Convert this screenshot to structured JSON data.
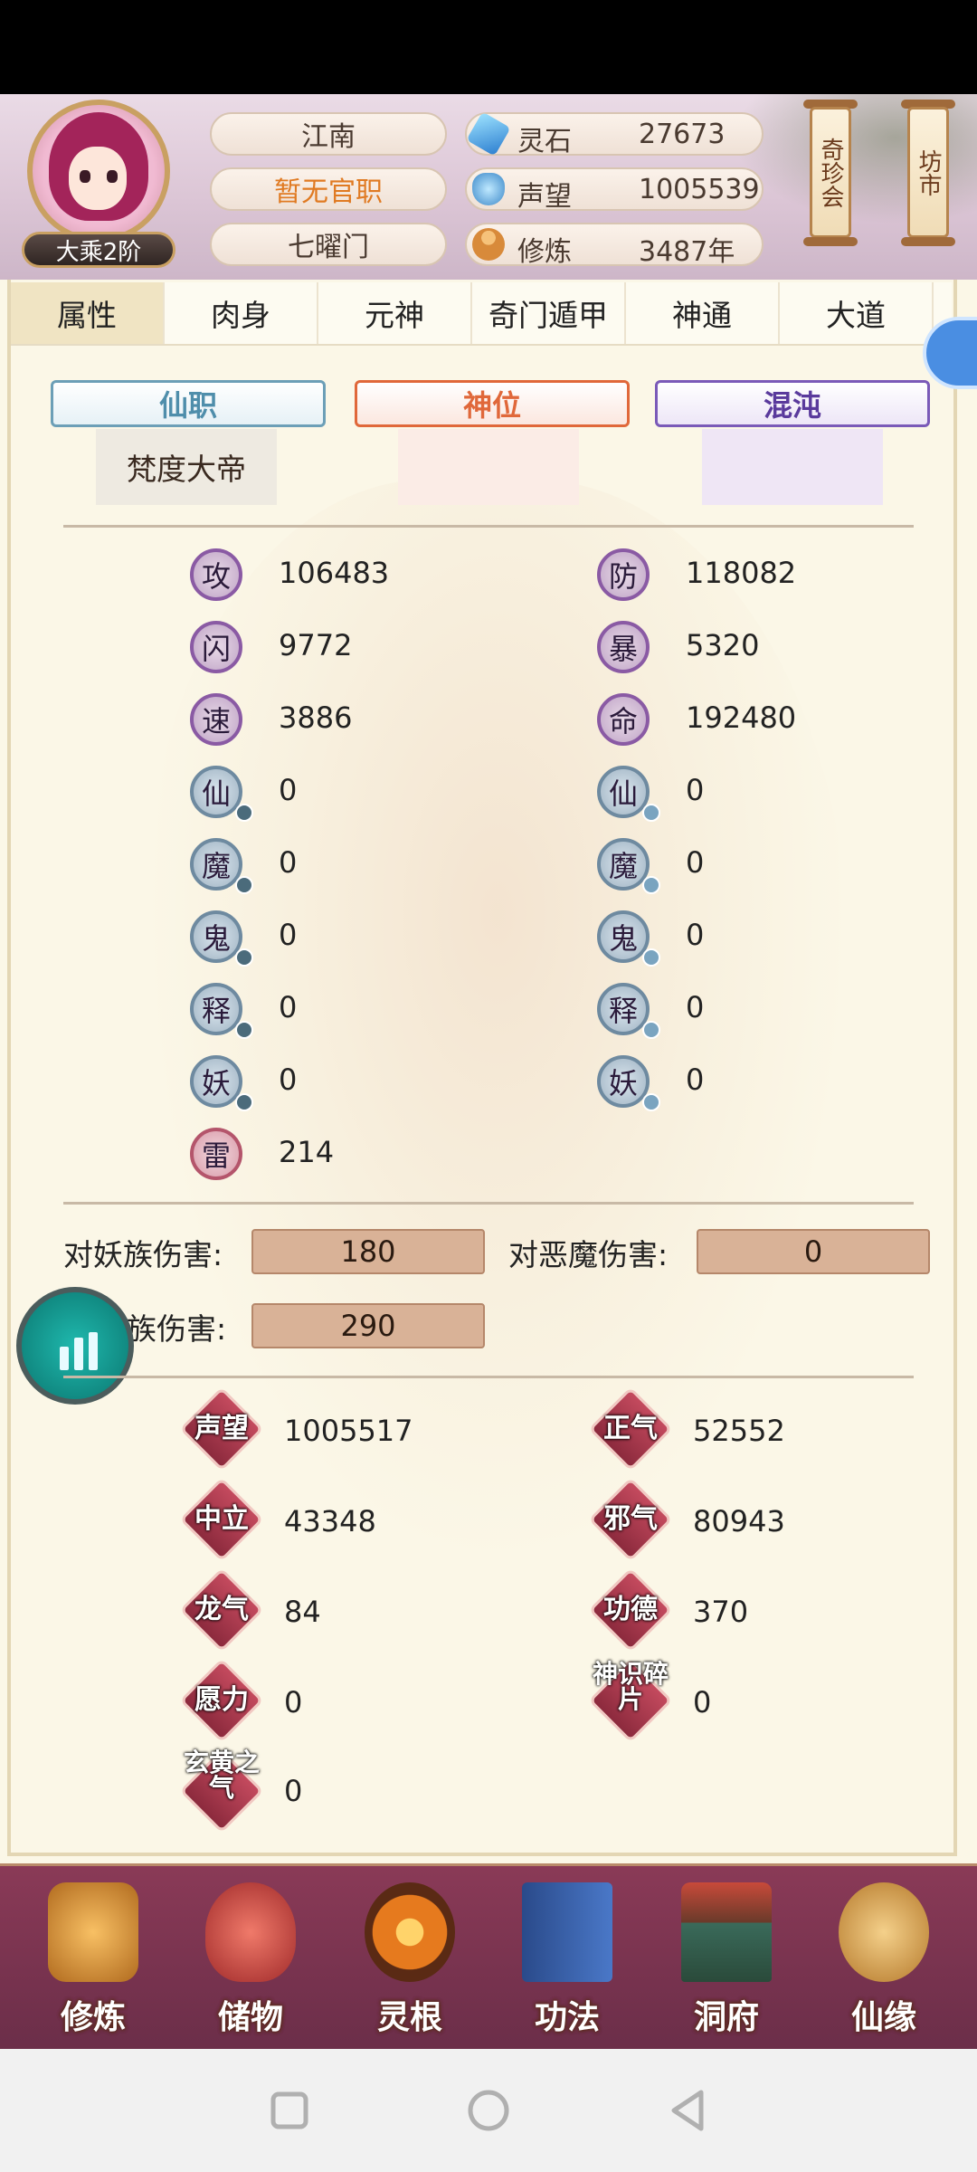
{
  "header": {
    "rank": "大乘2阶",
    "location": "江南",
    "official_post": "暂无官职",
    "sect": "七曜门",
    "resources": [
      {
        "label": "灵石",
        "value": "27673",
        "icon": "spirit-stone-icon"
      },
      {
        "label": "声望",
        "value": "1005539",
        "icon": "prestige-icon"
      },
      {
        "label": "修炼",
        "value": "3487年",
        "icon": "meditation-icon"
      }
    ],
    "shops": [
      "奇珍会",
      "坊市"
    ]
  },
  "tabs": [
    "属性",
    "肉身",
    "元神",
    "奇门遁甲",
    "神通",
    "大道"
  ],
  "active_tab": "属性",
  "titles": {
    "xianzhi": {
      "label": "仙职",
      "value": "梵度大帝"
    },
    "shenwei": {
      "label": "神位",
      "value": ""
    },
    "hundun": {
      "label": "混沌",
      "value": ""
    }
  },
  "stats_left": [
    {
      "label": "攻",
      "value": "106483"
    },
    {
      "label": "闪",
      "value": "9772"
    },
    {
      "label": "速",
      "value": "3886"
    },
    {
      "label": "仙",
      "value": "0"
    },
    {
      "label": "魔",
      "value": "0"
    },
    {
      "label": "鬼",
      "value": "0"
    },
    {
      "label": "释",
      "value": "0"
    },
    {
      "label": "妖",
      "value": "0"
    },
    {
      "label": "雷",
      "value": "214"
    }
  ],
  "stats_right": [
    {
      "label": "防",
      "value": "118082"
    },
    {
      "label": "暴",
      "value": "5320"
    },
    {
      "label": "命",
      "value": "192480"
    },
    {
      "label": "仙",
      "value": "0"
    },
    {
      "label": "魔",
      "value": "0"
    },
    {
      "label": "鬼",
      "value": "0"
    },
    {
      "label": "释",
      "value": "0"
    },
    {
      "label": "妖",
      "value": "0"
    }
  ],
  "damage": [
    {
      "label": "对妖族伤害:",
      "value": "180"
    },
    {
      "label": "对恶魔伤害:",
      "value": "0"
    },
    {
      "label": "族伤害:",
      "value": "290"
    }
  ],
  "reputation_left": [
    {
      "label": "声望",
      "value": "1005517"
    },
    {
      "label": "中立",
      "value": "43348"
    },
    {
      "label": "龙气",
      "value": "84"
    },
    {
      "label": "愿力",
      "value": "0"
    },
    {
      "label": "玄黄之气",
      "value": "0"
    }
  ],
  "reputation_right": [
    {
      "label": "正气",
      "value": "52552"
    },
    {
      "label": "邪气",
      "value": "80943"
    },
    {
      "label": "功德",
      "value": "370"
    },
    {
      "label": "神识碎片",
      "value": "0"
    }
  ],
  "bottom_nav": [
    {
      "label": "修炼",
      "icon": "cultivation-icon"
    },
    {
      "label": "储物",
      "icon": "storage-bag-icon"
    },
    {
      "label": "灵根",
      "icon": "spirit-root-icon"
    },
    {
      "label": "功法",
      "icon": "technique-book-icon"
    },
    {
      "label": "洞府",
      "icon": "cave-dwelling-icon"
    },
    {
      "label": "仙缘",
      "icon": "immortal-fate-icon"
    }
  ],
  "colors": {
    "panel_bg": "#fbf7e7",
    "official_post": "#e07a22",
    "nav_bg": "#7a3350",
    "xianzhi": "#6c9fb7",
    "shenwei": "#e0683a",
    "hundun": "#7a5ab8"
  }
}
